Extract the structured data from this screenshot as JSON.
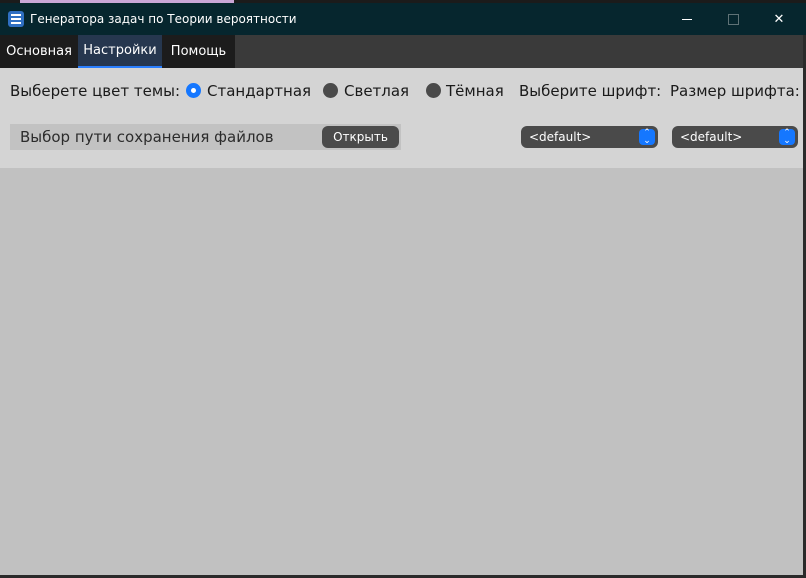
{
  "window": {
    "title": "Генератора задач по Теории вероятности",
    "controls": {
      "minimize": "—",
      "maximize": "☐",
      "close": "✕"
    }
  },
  "tabs": [
    {
      "label": "Основная",
      "active": false
    },
    {
      "label": "Настройки",
      "active": true
    },
    {
      "label": "Помощь",
      "active": false
    }
  ],
  "settings": {
    "theme_label": "Выберете цвет темы:",
    "theme_options": [
      {
        "label": "Стандартная",
        "selected": true
      },
      {
        "label": "Светлая",
        "selected": false
      },
      {
        "label": "Тёмная",
        "selected": false
      }
    ],
    "font_label": "Выберите шрифт:",
    "font_size_label": "Размер шрифта:",
    "save_path_label": "Выбор пути сохранения файлов",
    "open_button": "Открыть",
    "font_select_value": "<default>",
    "font_size_select_value": "<default>"
  },
  "colors": {
    "titlebar": "#06262e",
    "accent": "#1577ff",
    "panel": "#d4d4d4",
    "content": "#c1c1c1"
  }
}
